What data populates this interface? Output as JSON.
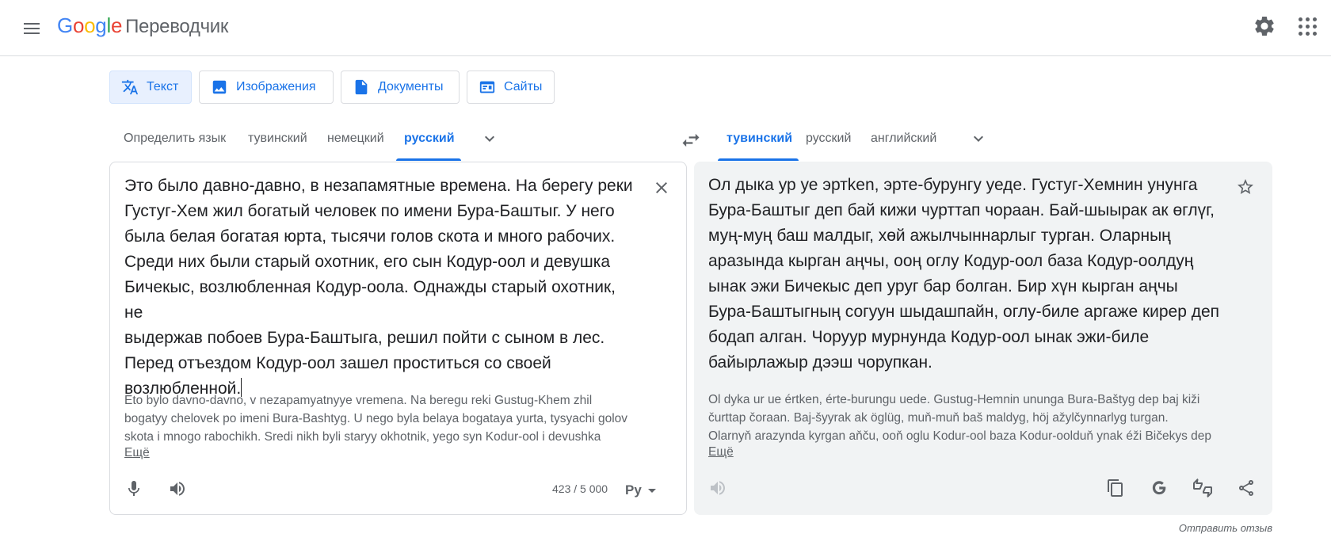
{
  "header": {
    "logo_letters": [
      "G",
      "o",
      "o",
      "g",
      "l",
      "e"
    ],
    "product_name": "Переводчик",
    "icons": {
      "menu": "menu-icon",
      "settings": "gear-icon",
      "apps": "apps-grid-icon"
    }
  },
  "mode_tabs": [
    {
      "label": "Текст",
      "icon": "translate-icon",
      "active": true
    },
    {
      "label": "Изображения",
      "icon": "image-icon",
      "active": false
    },
    {
      "label": "Документы",
      "icon": "document-icon",
      "active": false
    },
    {
      "label": "Сайты",
      "icon": "website-icon",
      "active": false
    }
  ],
  "source_langs": {
    "tabs": [
      "Определить язык",
      "тувинский",
      "немецкий",
      "русский"
    ],
    "selected": "русский"
  },
  "target_langs": {
    "tabs": [
      "тувинский",
      "русский",
      "английский"
    ],
    "selected": "тувинский"
  },
  "source": {
    "lines": [
      "Это было давно-давно, в незапамятные времена. На берегу реки",
      "Густуг-Хем жил богатый человек по имени Бура-Баштыг. У него",
      "была белая богатая юрта, тысячи голов скота и много рабочих.",
      "Среди них были старый охотник, его сын Кодур-оол и девушка",
      "Бичекыс, возлюбленная Кодур-оола. Однажды старый охотник, не",
      "выдержав побоев Бура-Баштыга, решил пойти с сыном в лес.",
      "Перед отъездом Кодур-оол зашел проститься со своей",
      "возлюбленной."
    ],
    "transliteration": [
      "Eto bylo davno-davno, v nezapamyatnyye vremena. Na beregu reki Gustug-Khem zhil",
      "bogatyy chelovek po imeni Bura-Bashtyg. U nego byla belaya bogataya yurta, tysyachi golov",
      "skota i mnogo rabochikh. Sredi nikh byli staryy okhotnik, yego syn Kodur-ool i devushka"
    ],
    "more_label": "Ещё",
    "char_count": "423 / 5 000",
    "ime_label": "Ру"
  },
  "target": {
    "lines": [
      "Ол дыка ур уе эртken, эрте-бурунгу уеде. Густуг-Хемнин унунга",
      "Бура-Баштыг деп бай кижи чурттап чораан. Бай-шыырак ак өглүг,",
      "муң-муң баш малдыг, хөй ажылчыннарлыг турган. Оларның",
      "аразында кырган аңчы, ооң оглу Кодур-оол база Кодур-оолдуң",
      "ынак эжи Бичекыс деп уруг бар болган. Бир хүн кырган аңчы",
      "Бура-Баштыгның согуун шыдашпайн, оглу-биле аргаже кирер деп",
      "бодап алган. Чоруур мурнунда Кодур-оол ынак эжи-биле",
      "байырлажыр дээш чорупкан."
    ],
    "transliteration": [
      "Ol dyka ur ue értken, érte-burungu uede. Gustug-Hemnin ununga Bura-Baštyg dep baj kiži",
      "čurttap čoraan. Baj-šyyrak ak öglüg, muň-muň baš maldyg, höj ažylčynnarlyg turgan.",
      "Olarnyň arazynda kyrgan aňču, ooň oglu Kodur-ool baza Kodur-oolduň ynak éži Bičekys dep"
    ],
    "more_label": "Ещё"
  },
  "feedback_label": "Отправить отзыв",
  "colors": {
    "accent": "#1a73e8",
    "active_tab_bg": "#e8f0fe",
    "target_bg": "#f1f3f4",
    "muted": "#5f6368"
  }
}
